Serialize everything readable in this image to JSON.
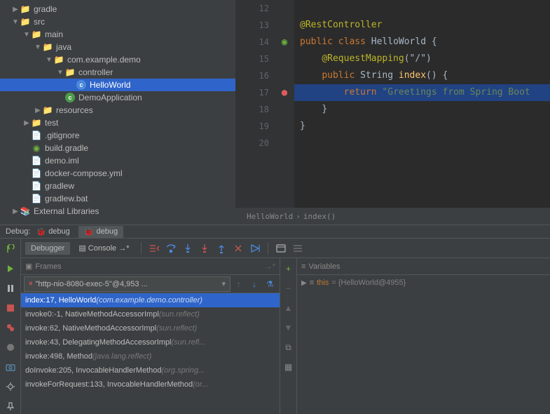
{
  "tree": {
    "gradle": "gradle",
    "src": "src",
    "main": "main",
    "java": "java",
    "package": "com.example.demo",
    "controller": "controller",
    "helloWorld": "HelloWorld",
    "demoApp": "DemoApplication",
    "resources": "resources",
    "test": "test",
    "gitignore": ".gitignore",
    "buildGradle": "build.gradle",
    "demoIml": "demo.iml",
    "dockerCompose": "docker-compose.yml",
    "gradlew": "gradlew",
    "gradlewBat": "gradlew.bat",
    "externalLibs": "External Libraries"
  },
  "editor": {
    "lines": [
      "12",
      "13",
      "14",
      "15",
      "16",
      "17",
      "18",
      "19",
      "20"
    ],
    "ann_rest": "@RestController",
    "kw_public": "public",
    "kw_class": "class",
    "cls_name": "HelloWorld",
    "brace_open": " {",
    "ann_reqmap": "@RequestMapping",
    "reqmap_arg": "(\"/\")",
    "kw_string": "String",
    "mtd_index": "index",
    "mtd_parens": "() {",
    "kw_return": "return",
    "str_greet": "\"Greetings from Spring Boot",
    "brace_close1": "}",
    "brace_close2": "}"
  },
  "breadcrumb": {
    "cls": "HelloWorld",
    "sep": "›",
    "mtd": "index()"
  },
  "debug": {
    "label": "Debug:",
    "tab1": "debug",
    "tab2": "debug",
    "debugger": "Debugger",
    "console": "Console",
    "frames_label": "Frames",
    "variables_label": "Variables",
    "thread": "\"http-nio-8080-exec-5\"@4,953 ...",
    "frames": [
      {
        "loc": "index:17, HelloWorld",
        "pkg": "(com.example.demo.controller)"
      },
      {
        "loc": "invoke0:-1, NativeMethodAccessorImpl",
        "pkg": "(sun.reflect)"
      },
      {
        "loc": "invoke:62, NativeMethodAccessorImpl",
        "pkg": "(sun.reflect)"
      },
      {
        "loc": "invoke:43, DelegatingMethodAccessorImpl",
        "pkg": "(sun.refl..."
      },
      {
        "loc": "invoke:498, Method",
        "pkg": "(java.lang.reflect)"
      },
      {
        "loc": "doInvoke:205, InvocableHandlerMethod",
        "pkg": "(org.spring..."
      },
      {
        "loc": "invokeForRequest:133, InvocableHandlerMethod",
        "pkg": "(or..."
      }
    ],
    "var_this": "this",
    "var_this_val": "= {HelloWorld@4955}"
  }
}
